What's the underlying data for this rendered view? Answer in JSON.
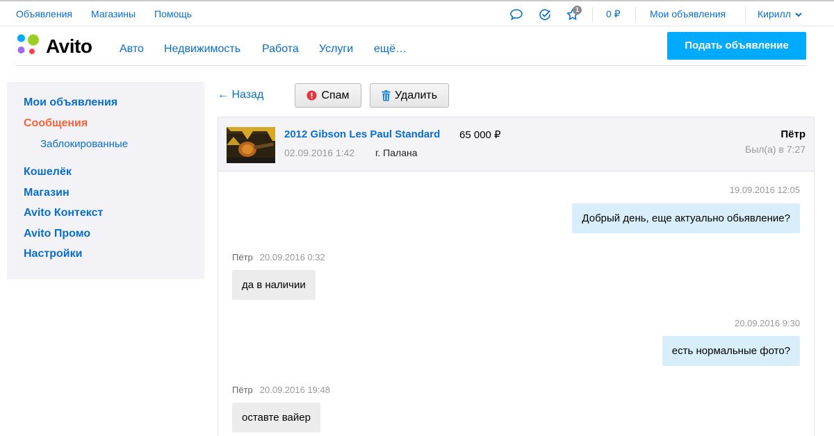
{
  "topbar": {
    "links": [
      "Объявления",
      "Магазины",
      "Помощь"
    ],
    "notifications_count": "1",
    "wallet": "0 ₽",
    "my_ads": "Мои объявления",
    "user": "Кирилл"
  },
  "header": {
    "logo": "Avito",
    "categories": [
      "Авто",
      "Недвижимость",
      "Работа",
      "Услуги",
      "ещё…"
    ],
    "post_button": "Подать объявление"
  },
  "sidebar": {
    "items": [
      {
        "label": "Мои объявления"
      },
      {
        "label": "Сообщения",
        "active": true
      },
      {
        "label": "Заблокированные",
        "sub": true
      },
      {
        "label": "Кошелёк"
      },
      {
        "label": "Магазин"
      },
      {
        "label": "Avito Контекст"
      },
      {
        "label": "Avito Промо"
      },
      {
        "label": "Настройки"
      }
    ]
  },
  "toolbar": {
    "back": "← Назад",
    "spam": "Спам",
    "delete": "Удалить"
  },
  "ad": {
    "title": "2012 Gibson Les Paul Standard",
    "price": "65 000 ₽",
    "date": "02.09.2016 1:42",
    "city": "г. Палана",
    "seller_name": "Пётр",
    "seller_seen": "Был(а) в 7:27"
  },
  "messages": [
    {
      "direction": "out",
      "time": "19.09.2016 12:05",
      "text": "Добрый день, еще актуально обьявление?"
    },
    {
      "direction": "in",
      "author": "Пётр",
      "time": "20.09.2016 0:32",
      "text": "да в наличии"
    },
    {
      "direction": "out",
      "time": "20.09.2016 9:30",
      "text": "есть нормальные фото?"
    },
    {
      "direction": "in",
      "author": "Пётр",
      "time": "20.09.2016 19:48",
      "text": "оставте вайер"
    }
  ],
  "colors": {
    "link": "#0a6ec9",
    "active": "#f2633e",
    "primary_button": "#00aaff",
    "outgoing_bubble": "#d8eefa",
    "incoming_bubble": "#ececec"
  }
}
